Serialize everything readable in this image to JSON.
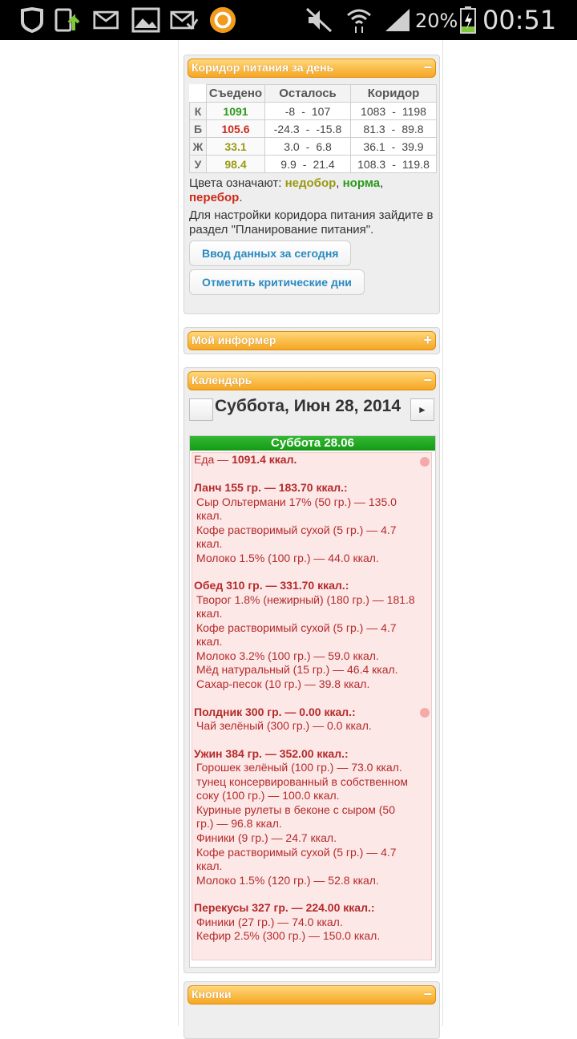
{
  "statusbar": {
    "battery": "20%",
    "time": "00:51"
  },
  "corridor": {
    "title": "Коридор питания за день",
    "toggle": "−",
    "headers": [
      "Съедено",
      "Осталось",
      "Коридор"
    ],
    "rows": [
      {
        "label": "К",
        "eaten": "1091",
        "left_from": "-8",
        "left_to": "107",
        "corr_from": "1083",
        "corr_to": "1198"
      },
      {
        "label": "Б",
        "eaten": "105.6",
        "left_from": "-24.3",
        "left_to": "-15.8",
        "corr_from": "81.3",
        "corr_to": "89.8"
      },
      {
        "label": "Ж",
        "eaten": "33.1",
        "left_from": "3.0",
        "left_to": "6.8",
        "corr_from": "36.1",
        "corr_to": "39.9"
      },
      {
        "label": "У",
        "eaten": "98.4",
        "left_from": "9.9",
        "left_to": "21.4",
        "corr_from": "108.3",
        "corr_to": "119.8"
      }
    ],
    "dash": "-",
    "legend_prefix": "Цвета означают: ",
    "legend_under": "недобор",
    "legend_comma": ", ",
    "legend_norm": "норма",
    "legend_comma2": ",",
    "legend_over": "перебор",
    "legend_dot": ".",
    "settings_text": "Для настройки коридора питания зайдите в раздел \"Планирование питания\".",
    "btn_input": "Ввод данных за сегодня",
    "btn_critical": "Отметить критические дни"
  },
  "informer": {
    "title": "Мой информер",
    "toggle": "+"
  },
  "calendar": {
    "title": "Календарь",
    "toggle": "−",
    "nav_next": "►",
    "date_title": "Суббота, Июн 28, 2014",
    "day_header": "Суббота 28.06",
    "lines": [
      {
        "t": "Еда — ",
        "b": "1091.4 ккал."
      },
      {
        "t": "",
        "b": "Ланч 155 гр. — 183.70 ккал.:"
      },
      {
        "t": "Сыр Ольтермани 17% (50 гр.) — 135.0"
      },
      {
        "t": "ккал."
      },
      {
        "t": "Кофе растворимый сухой (5 гр.) — 4.7"
      },
      {
        "t": "ккал."
      },
      {
        "t": "Молоко 1.5% (100 гр.) — 44.0 ккал."
      },
      {
        "t": "",
        "b": "Обед 310 гр. — 331.70 ккал.:"
      },
      {
        "t": "Творог 1.8% (нежирный) (180 гр.) — 181.8"
      },
      {
        "t": "ккал."
      },
      {
        "t": "Кофе растворимый сухой (5 гр.) — 4.7"
      },
      {
        "t": "ккал."
      },
      {
        "t": "Молоко 3.2% (100 гр.) — 59.0 ккал."
      },
      {
        "t": "Мёд натуральный (15 гр.) — 46.4 ккал."
      },
      {
        "t": "Сахар-песок (10 гр.) — 39.8 ккал."
      },
      {
        "t": "",
        "b": "Полдник 300 гр. — 0.00 ккал.:"
      },
      {
        "t": "Чай зелёный (300 гр.) — 0.0 ккал."
      },
      {
        "t": "",
        "b": "Ужин 384 гр. — 352.00 ккал.:"
      },
      {
        "t": "Горошек зелёный (100 гр.) — 73.0 ккал."
      },
      {
        "t": "тунец консервированный в собственном"
      },
      {
        "t": "соку (100 гр.) — 100.0 ккал."
      },
      {
        "t": "Куриные рулеты в беконе с сыром (50"
      },
      {
        "t": "гр.) — 96.8 ккал."
      },
      {
        "t": "Финики (9 гр.) — 24.7 ккал."
      },
      {
        "t": "Кофе растворимый сухой (5 гр.) — 4.7"
      },
      {
        "t": "ккал."
      },
      {
        "t": "Молоко 1.5% (120 гр.) — 52.8 ккал."
      },
      {
        "t": "",
        "b": "Перекусы 327 гр. — 224.00 ккал.:"
      },
      {
        "t": "Финики (27 гр.) — 74.0 ккал."
      },
      {
        "t": "Кефир 2.5% (300 гр.) — 150.0 ккал."
      }
    ]
  },
  "buttons_panel": {
    "title": "Кнопки",
    "toggle": "−"
  }
}
